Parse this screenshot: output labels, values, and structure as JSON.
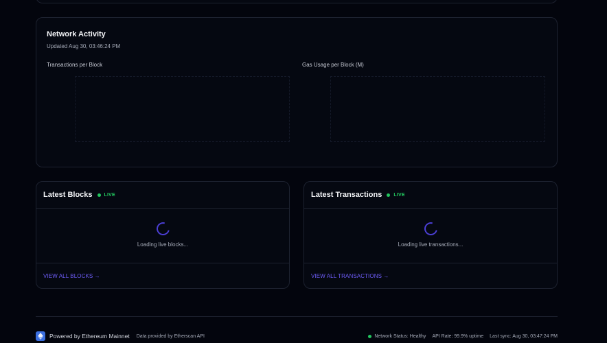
{
  "network_activity": {
    "title": "Network Activity",
    "updated": "Updated Aug 30, 03:46:24 PM",
    "charts": [
      {
        "label": "Transactions per Block"
      },
      {
        "label": "Gas Usage per Block (M)"
      }
    ]
  },
  "latest_blocks": {
    "title": "Latest Blocks",
    "live_label": "LIVE",
    "loading_text": "Loading live blocks...",
    "view_all_label": "VIEW ALL BLOCKS →"
  },
  "latest_transactions": {
    "title": "Latest Transactions",
    "live_label": "LIVE",
    "loading_text": "Loading live transactions...",
    "view_all_label": "VIEW ALL TRANSACTIONS →"
  },
  "footer": {
    "logo_icon": "ethereum-icon",
    "powered_by": "Powered by Ethereum Mainnet",
    "provided_by": "Data provided by Etherscan API",
    "network_status": "Network Status: Healthy",
    "api_rate": "API Rate: 99.9% uptime",
    "last_sync": "Last sync: Aug 30, 03:47:24 PM"
  },
  "colors": {
    "background": "#03050d",
    "live_green": "#22c55e",
    "accent_purple": "#6d5cf6"
  }
}
